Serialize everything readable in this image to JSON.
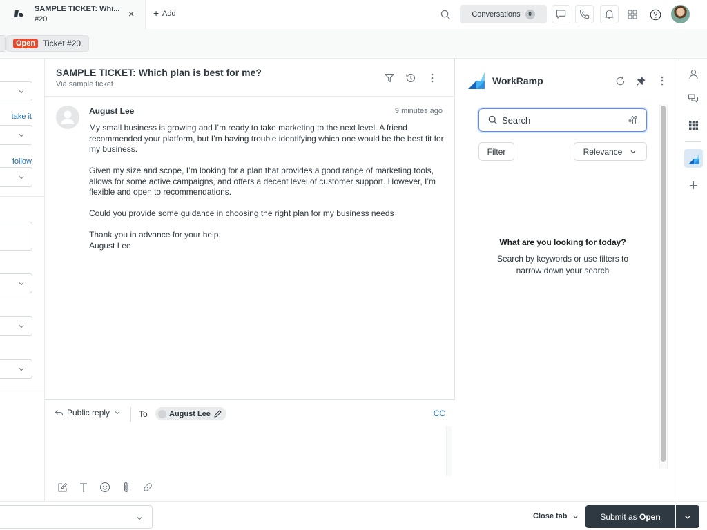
{
  "top_bar": {
    "tab": {
      "title": "SAMPLE TICKET: Whi...",
      "subtitle": "#20",
      "close_icon": "×",
      "icon": "zendesk-logo-icon"
    },
    "add_label": "Add",
    "add_icon": "+",
    "search_icon": "search-icon",
    "conversations": {
      "label": "Conversations",
      "count": "0"
    },
    "icons": [
      "chat-icon",
      "phone-icon",
      "bell-icon",
      "apps-grid-icon",
      "help-icon",
      "user-avatar"
    ]
  },
  "sub_bar": {
    "status_badge": "Open",
    "ticket_label": "Ticket #20",
    "status_color": "#e34f32"
  },
  "left_panel": {
    "links": [
      "take it",
      "follow"
    ]
  },
  "ticket": {
    "title": "SAMPLE TICKET: Which plan is best for me?",
    "via": "Via sample ticket",
    "header_icons": [
      "filter-icon",
      "history-icon",
      "more-icon"
    ],
    "message": {
      "author": "August Lee",
      "time": "9 minutes ago",
      "paragraphs": [
        "My small business is growing and I’m ready to take marketing to the next level. A friend recommended your platform, but I’m having trouble identifying which one would be the best fit for my business.",
        "Given my size and scope, I’m looking for a plan that provides a good range of marketing tools, allows for some active campaigns, and offers a decent level of customer support. However, I’m flexible and open to recommendations.",
        "Could you provide some guidance in choosing the right plan for my business needs",
        "Thank you in advance for your help,"
      ],
      "signature": "August Lee"
    }
  },
  "composer": {
    "reply_type": "Public reply",
    "to_label": "To",
    "recipient": "August Lee",
    "cc_label": "CC",
    "toolbar_icons": [
      "compose-icon",
      "text-format-icon",
      "emoji-icon",
      "attachment-icon",
      "link-icon"
    ]
  },
  "app_panel": {
    "name": "WorkRamp",
    "header_icons": [
      "refresh-icon",
      "pin-icon",
      "more-icon"
    ],
    "search": {
      "placeholder": "Search",
      "value": ""
    },
    "filter_label": "Filter",
    "sort_label": "Relevance",
    "empty_title": "What are you looking for today?",
    "empty_subtitle_line1": "Search by keywords or use filters to",
    "empty_subtitle_line2": "narrow down your search",
    "brand_colors": {
      "dark": "#1565c0",
      "mid": "#2f8fe0",
      "light": "#7fd1f7"
    }
  },
  "rail": {
    "icons": [
      "user-icon",
      "conversations-icon",
      "apps-icon",
      "workramp-app-icon",
      "add-icon"
    ]
  },
  "footer": {
    "close_tab_label": "Close tab",
    "submit_prefix": "Submit as",
    "submit_status": "Open"
  }
}
